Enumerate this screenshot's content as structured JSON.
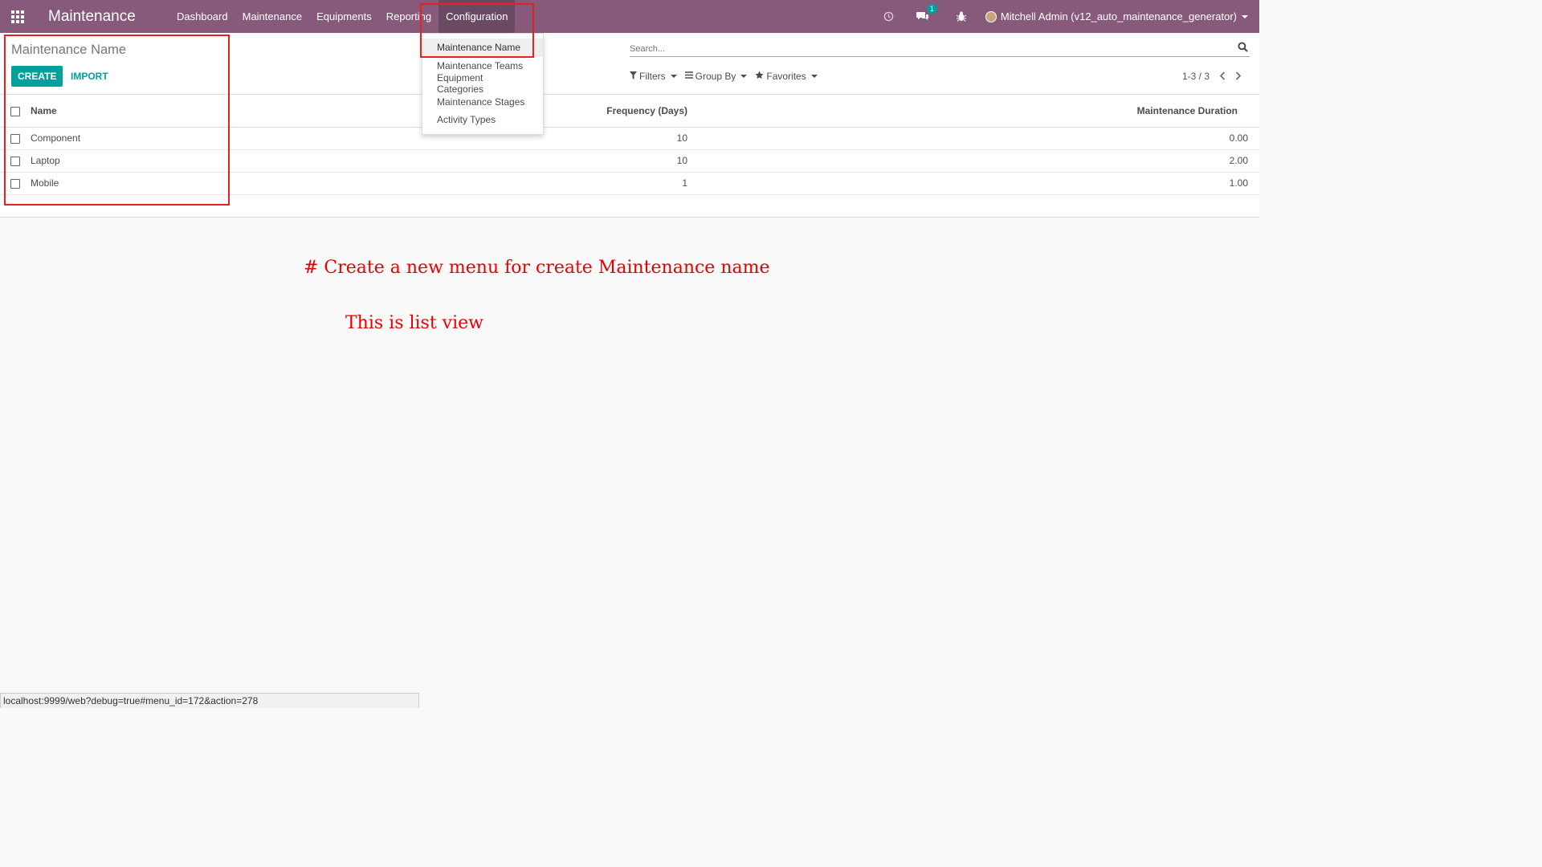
{
  "navbar": {
    "brand": "Maintenance",
    "menu": [
      "Dashboard",
      "Maintenance",
      "Equipments",
      "Reporting",
      "Configuration"
    ],
    "messages_badge": "1",
    "user": "Mitchell Admin (v12_auto_maintenance_generator)"
  },
  "config_menu": [
    "Maintenance Name",
    "Maintenance Teams",
    "Equipment Categories",
    "Maintenance Stages",
    "Activity Types"
  ],
  "control_panel": {
    "breadcrumb": "Maintenance Name",
    "create_label": "CREATE",
    "import_label": "IMPORT",
    "search_placeholder": "Search...",
    "filters_label": "Filters",
    "groupby_label": "Group By",
    "favorites_label": "Favorites",
    "pager": "1-3 / 3"
  },
  "list": {
    "headers": {
      "name": "Name",
      "frequency": "Frequency (Days)",
      "duration": "Maintenance Duration"
    },
    "rows": [
      {
        "name": "Component",
        "frequency": "10",
        "duration": "0.00"
      },
      {
        "name": "Laptop",
        "frequency": "10",
        "duration": "2.00"
      },
      {
        "name": "Mobile",
        "frequency": "1",
        "duration": "1.00"
      }
    ]
  },
  "annotations": {
    "line1": "# Create a new menu for create Maintenance name",
    "line2": "This is list view"
  },
  "statusbar": "localhost:9999/web?debug=true#menu_id=172&action=278",
  "colors": {
    "navbar": "#875a7b",
    "accent": "#00a09d",
    "annotation": "#e80000"
  }
}
